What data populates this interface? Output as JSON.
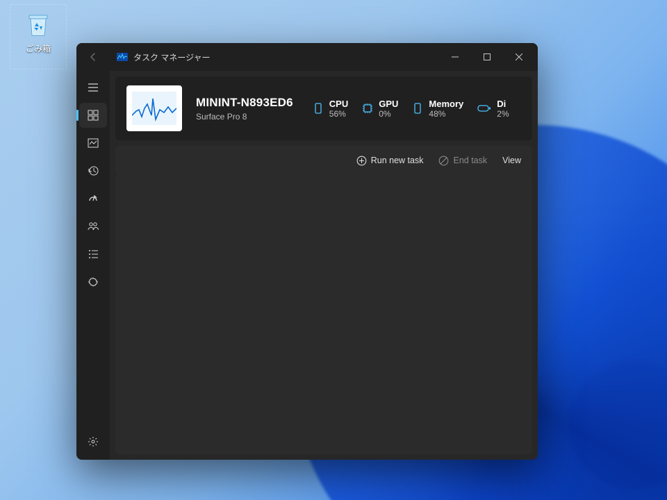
{
  "desktop": {
    "recycle_bin_label": "ごみ箱"
  },
  "window": {
    "title": "タスク マネージャー",
    "controls": {
      "minimize": "Minimize",
      "maximize": "Maximize",
      "close": "Close"
    }
  },
  "header": {
    "host_name": "MININT-N893ED6",
    "host_sub": "Surface Pro 8",
    "metrics": {
      "cpu": {
        "label": "CPU",
        "value": "56%"
      },
      "gpu": {
        "label": "GPU",
        "value": "0%"
      },
      "memory": {
        "label": "Memory",
        "value": "48%"
      },
      "disk": {
        "label": "Di",
        "value": "2%"
      }
    }
  },
  "toolbar": {
    "run_new_task": "Run new task",
    "end_task": "End task",
    "view": "View"
  }
}
